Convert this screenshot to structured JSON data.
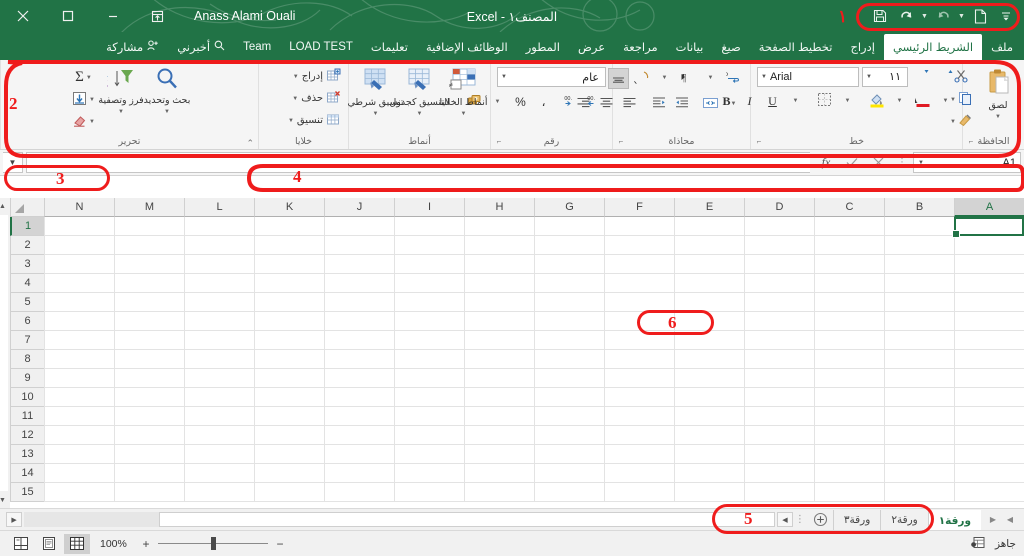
{
  "window": {
    "title": "المصنف١ - Excel",
    "username": "Anass Alami Ouali",
    "controls": {
      "close": "close-icon",
      "maximize": "maximize-icon",
      "minimize": "minimize-icon",
      "ribbon_display": "ribbon-display-options-icon"
    }
  },
  "quick_access": {
    "customize": "customize-qat-icon",
    "new": "new-file-icon",
    "undo": "undo-icon",
    "redo": "redo-icon",
    "save": "save-icon"
  },
  "tabs": [
    {
      "label": "ملف",
      "active": false
    },
    {
      "label": "الشريط الرئيسي",
      "active": true
    },
    {
      "label": "إدراج",
      "active": false
    },
    {
      "label": "تخطيط الصفحة",
      "active": false
    },
    {
      "label": "صيغ",
      "active": false
    },
    {
      "label": "بيانات",
      "active": false
    },
    {
      "label": "مراجعة",
      "active": false
    },
    {
      "label": "عرض",
      "active": false
    },
    {
      "label": "المطور",
      "active": false
    },
    {
      "label": "الوظائف الإضافية",
      "active": false
    },
    {
      "label": "تعليمات",
      "active": false
    },
    {
      "label": "LOAD TEST",
      "active": false
    },
    {
      "label": "Team",
      "active": false
    },
    {
      "label": "أخبرني",
      "active": false,
      "icon": "search-icon"
    },
    {
      "label": "مشاركة",
      "active": false,
      "icon": "share-person-icon"
    }
  ],
  "ribbon": {
    "groups": {
      "clipboard": {
        "label": "الحافظة",
        "paste": "لصق",
        "cut": "cut-scissors-icon",
        "copy": "copy-icon",
        "format_painter": "format-painter-icon"
      },
      "font": {
        "label": "خط",
        "font_name": "Arial",
        "font_size": "١١",
        "bold": "B",
        "italic": "I",
        "underline": "U",
        "borders": "borders-icon",
        "fill_color": "fill-color-icon",
        "font_color": "font-color-icon",
        "grow_font": "grow-font-icon",
        "shrink_font": "shrink-font-icon"
      },
      "alignment": {
        "label": "محاذاة",
        "align_top": "align-top-icon",
        "align_middle": "align-middle-icon",
        "align_bottom": "align-bottom-icon",
        "align_right": "align-right-icon",
        "align_center": "align-center-icon",
        "align_left": "align-left-icon",
        "orientation": "text-orientation-icon",
        "text_direction": "text-direction-rtl-icon",
        "wrap_text": "wrap-text-icon",
        "merge_center": "merge-and-center-icon",
        "indent_increase": "increase-indent-icon",
        "indent_decrease": "decrease-indent-icon"
      },
      "number": {
        "label": "رقم",
        "format_value": "عام",
        "accounting": "accounting-format-icon",
        "percent": "%",
        "comma": "،",
        "increase_decimal": "increase-decimal-icon",
        "decrease_decimal": "decrease-decimal-icon"
      },
      "styles": {
        "label": "أنماط",
        "conditional_formatting": "تنسيق شرطي",
        "format_as_table": "التنسيق كجدول",
        "cell_styles": "أنماط الخلايا"
      },
      "cells": {
        "label": "خلايا",
        "insert": "إدراج",
        "delete": "حذف",
        "format": "تنسيق"
      },
      "editing": {
        "label": "تحرير",
        "autosum": "Σ",
        "fill": "fill-down-icon",
        "clear": "clear-eraser-icon",
        "sort_filter": "فرز وتصفية",
        "find_select": "بحث وتحديد"
      }
    }
  },
  "formula_bar": {
    "name_box": "A1",
    "cancel": "cancel-x-icon",
    "enter": "enter-check-icon",
    "function": "fx",
    "value": "",
    "expand": "expand-formula-bar-icon"
  },
  "grid": {
    "columns": [
      "A",
      "B",
      "C",
      "D",
      "E",
      "F",
      "G",
      "H",
      "I",
      "J",
      "K",
      "L",
      "M",
      "N"
    ],
    "rows": [
      "1",
      "2",
      "3",
      "4",
      "5",
      "6",
      "7",
      "8",
      "9",
      "10",
      "11",
      "12",
      "13",
      "14",
      "15"
    ],
    "selected_cell": "A1"
  },
  "sheet_tabs": {
    "tabs": [
      {
        "label": "ورقة١",
        "active": true
      },
      {
        "label": "ورقة٢",
        "active": false
      },
      {
        "label": "ورقة٣",
        "active": false
      }
    ],
    "add_sheet": "add-sheet-icon",
    "nav_prev": "previous-sheet-icon",
    "nav_next": "next-sheet-icon"
  },
  "status_bar": {
    "ready": "جاهز",
    "record_macro": "record-macro-icon",
    "view_normal": "normal-view-icon",
    "view_page_layout": "page-layout-view-icon",
    "view_page_break": "page-break-view-icon",
    "zoom_out": "−",
    "zoom_in": "+",
    "zoom_level": "100%"
  },
  "annotations": [
    {
      "id": "1",
      "number": "١",
      "target": "quick-access-toolbar"
    },
    {
      "id": "2",
      "number": "2",
      "target": "ribbon"
    },
    {
      "id": "3",
      "number": "3",
      "target": "name-box"
    },
    {
      "id": "4",
      "number": "4",
      "target": "formula-bar"
    },
    {
      "id": "5",
      "number": "5",
      "target": "sheet-tabs"
    },
    {
      "id": "6",
      "number": "6",
      "target": "grid-area"
    }
  ],
  "colors": {
    "brand_green": "#217346",
    "annotation_red": "#ef1c1c",
    "ribbon_bg": "#f5f5f5"
  }
}
